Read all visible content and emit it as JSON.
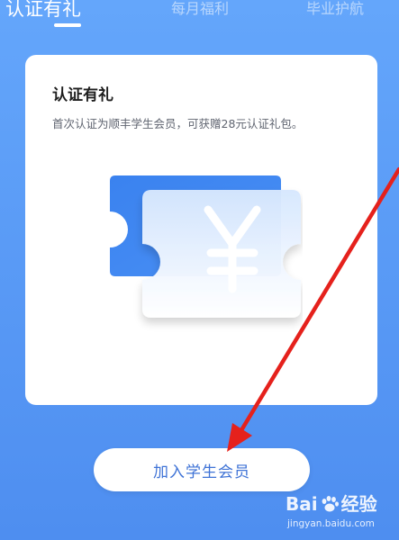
{
  "tabs": [
    {
      "label": "认证有礼",
      "active": true
    },
    {
      "label": "每月福利",
      "active": false
    },
    {
      "label": "毕业护航",
      "active": false
    }
  ],
  "card": {
    "title": "认证有礼",
    "description": "首次认证为顺丰学生会员，可获赠28元认证礼包。",
    "illustration": {
      "icon": "yen-coupon-icon",
      "symbol": "¥"
    }
  },
  "join_button": {
    "label": "加入学生会员"
  },
  "watermark": {
    "brand_left": "Bai",
    "brand_right": "经验",
    "url": "jingyan.baidu.com"
  },
  "colors": {
    "background_top": "#64a6fb",
    "background_bottom": "#4e8ef0",
    "card": "#ffffff",
    "button_text": "#3f73d6",
    "coupon_back": "#3d85f0",
    "annotation_arrow": "#e5211c"
  }
}
